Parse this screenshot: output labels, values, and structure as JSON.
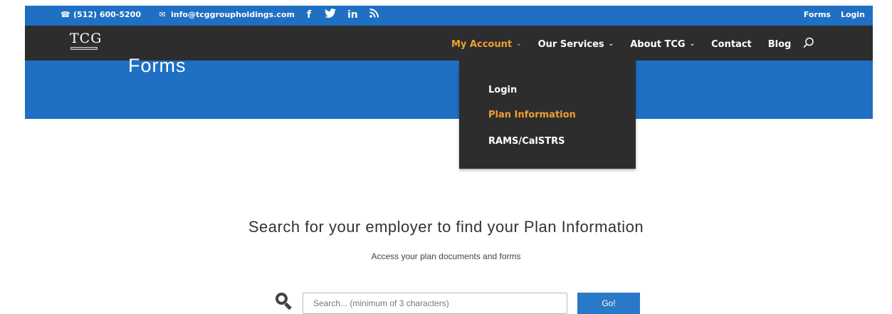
{
  "topbar": {
    "phone": "(512) 600-5200",
    "email": "info@tcggroupholdings.com",
    "phone_icon": "phone-icon",
    "email_icon": "mail-icon",
    "social": [
      {
        "name": "facebook-icon",
        "glyph": "f"
      },
      {
        "name": "twitter-icon",
        "glyph": "🐦"
      },
      {
        "name": "linkedin-icon",
        "glyph": "in"
      },
      {
        "name": "rss-icon",
        "glyph": "〵"
      }
    ],
    "links": {
      "forms": "Forms",
      "login": "Login"
    },
    "color": "#1f6fc2"
  },
  "logo": {
    "letters": "TCG",
    "subtext": "GROUP HOLDINGS"
  },
  "nav": {
    "items": [
      {
        "label": "My Account",
        "has_menu": true,
        "active": true
      },
      {
        "label": "Our Services",
        "has_menu": true,
        "active": false
      },
      {
        "label": "About TCG",
        "has_menu": true,
        "active": false
      },
      {
        "label": "Contact",
        "has_menu": false,
        "active": false
      },
      {
        "label": "Blog",
        "has_menu": false,
        "active": false
      }
    ],
    "search_icon": "search-icon",
    "active_color": "#f0a030",
    "bg_color": "#2d2d2d"
  },
  "hero": {
    "title": "Forms"
  },
  "dropdown": {
    "items": [
      {
        "label": "Login",
        "selected": false
      },
      {
        "label": "Plan Information",
        "selected": true
      },
      {
        "label": "RAMS/CalSTRS",
        "selected": false
      }
    ]
  },
  "content": {
    "headline": "Search for your employer to find your Plan Information",
    "subline": "Access your plan documents and forms"
  },
  "search": {
    "placeholder": "Search... (minimum of 3 characters)",
    "button_label": "Go!"
  }
}
